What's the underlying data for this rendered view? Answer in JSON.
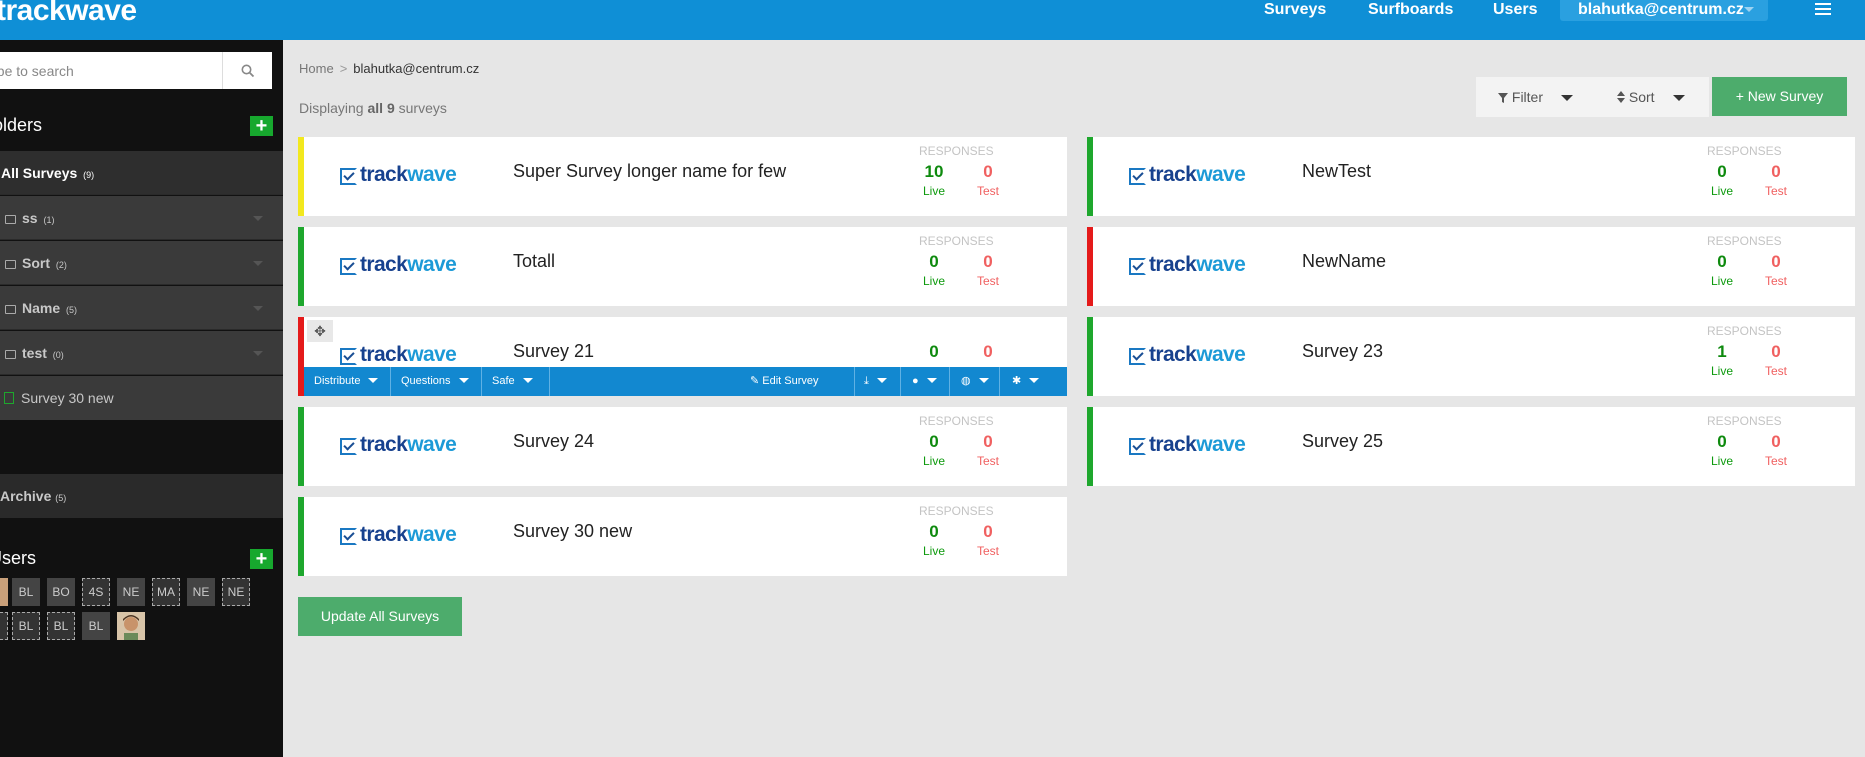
{
  "header": {
    "brand": "trackwave",
    "nav": {
      "surveys": "Surveys",
      "surfboards": "Surfboards",
      "users": "Users"
    },
    "account": "blahutka@centrum.cz"
  },
  "sidebar": {
    "search_placeholder": "Type to search",
    "folders_title": "Folders",
    "folders": [
      {
        "label": "All Surveys",
        "count": "(9)"
      },
      {
        "label": "ss",
        "count": "(1)"
      },
      {
        "label": "Sort",
        "count": "(2)"
      },
      {
        "label": "Name",
        "count": "(5)"
      },
      {
        "label": "test",
        "count": "(0)"
      }
    ],
    "loose_survey": "Survey 30 new",
    "archive": {
      "label": "Archive",
      "count": "(5)"
    },
    "users_title": "Users",
    "users_row1": [
      "BL",
      "BO",
      "4S",
      "NE",
      "MA",
      "NE",
      "NE"
    ],
    "users_row2": [
      "BL",
      "BL",
      "BL"
    ]
  },
  "breadcrumb": {
    "home": "Home",
    "separator": ">",
    "current": "blahutka@centrum.cz"
  },
  "summary": {
    "prefix": "Displaying",
    "bold": "all 9",
    "suffix": "surveys"
  },
  "toolbar": {
    "filter": "Filter",
    "sort": "Sort",
    "new_survey": "+ New Survey"
  },
  "labels": {
    "responses": "RESPONSES",
    "live": "Live",
    "test": "Test"
  },
  "logo": {
    "part1": "track",
    "part2": "wave"
  },
  "surveys": [
    {
      "title": "Super Survey longer name for few",
      "live": "10",
      "test": "0",
      "status": "yellow"
    },
    {
      "title": "NewTest",
      "live": "0",
      "test": "0",
      "status": "green"
    },
    {
      "title": "Totall",
      "live": "0",
      "test": "0",
      "status": "green"
    },
    {
      "title": "NewName",
      "live": "0",
      "test": "0",
      "status": "red"
    },
    {
      "title": "Survey 21",
      "live": "0",
      "test": "0",
      "status": "red"
    },
    {
      "title": "Survey 23",
      "live": "1",
      "test": "0",
      "status": "green"
    },
    {
      "title": "Survey 24",
      "live": "0",
      "test": "0",
      "status": "green"
    },
    {
      "title": "Survey 25",
      "live": "0",
      "test": "0",
      "status": "green"
    },
    {
      "title": "Survey 30 new",
      "live": "0",
      "test": "0",
      "status": "green"
    }
  ],
  "action_bar": {
    "distribute": "Distribute",
    "questions": "Questions",
    "safe": "Safe",
    "edit": "Edit Survey"
  },
  "update_all": "Update All Surveys",
  "colors": {
    "topbar": "#0f8fd6",
    "green_button": "#4dac6c",
    "status_green": "#1ea72d",
    "status_red": "#e41a1a",
    "status_yellow": "#f2e81e"
  }
}
